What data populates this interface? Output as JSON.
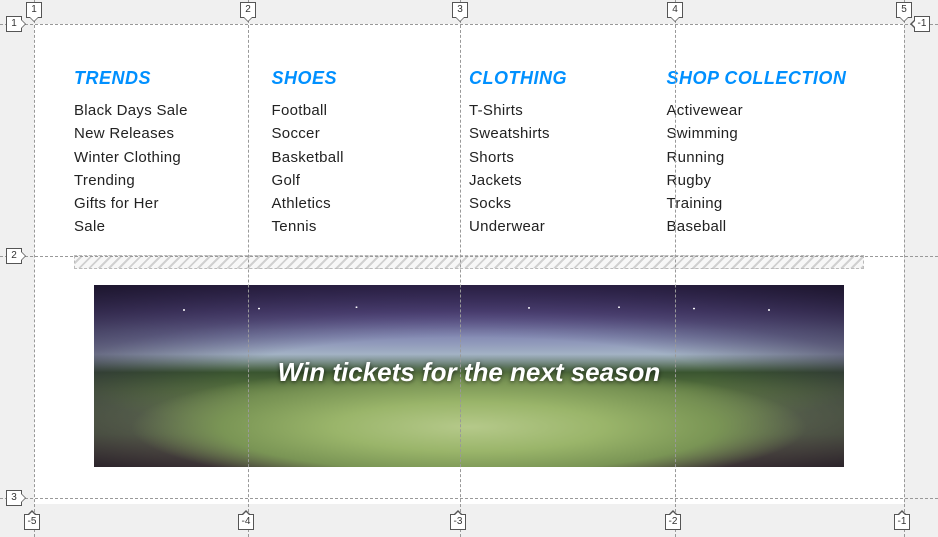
{
  "columns": [
    {
      "heading": "TRENDS",
      "items": [
        "Black Days Sale",
        "New Releases",
        "Winter Clothing",
        "Trending",
        "Gifts for Her",
        "Sale"
      ]
    },
    {
      "heading": "SHOES",
      "items": [
        "Football",
        "Soccer",
        "Basketball",
        "Golf",
        "Athletics",
        "Tennis"
      ]
    },
    {
      "heading": "CLOTHING",
      "items": [
        "T-Shirts",
        "Sweatshirts",
        "Shorts",
        "Jackets",
        "Socks",
        "Underwear"
      ]
    },
    {
      "heading": "SHOP COLLECTION",
      "items": [
        "Activewear",
        "Swimming",
        "Running",
        "Rugby",
        "Training",
        "Baseball"
      ]
    }
  ],
  "banner": {
    "caption": "Win tickets for the next season"
  },
  "grid": {
    "top_markers": [
      "1",
      "2",
      "3",
      "4",
      "5"
    ],
    "bottom_markers": [
      "-5",
      "-4",
      "-3",
      "-2",
      "-1"
    ],
    "left_markers": [
      "1",
      "2",
      "3"
    ],
    "right_markers": [
      "-1"
    ],
    "vlines_x": [
      34,
      248,
      460,
      675,
      904
    ],
    "hlines_y": [
      24,
      256,
      498
    ]
  }
}
